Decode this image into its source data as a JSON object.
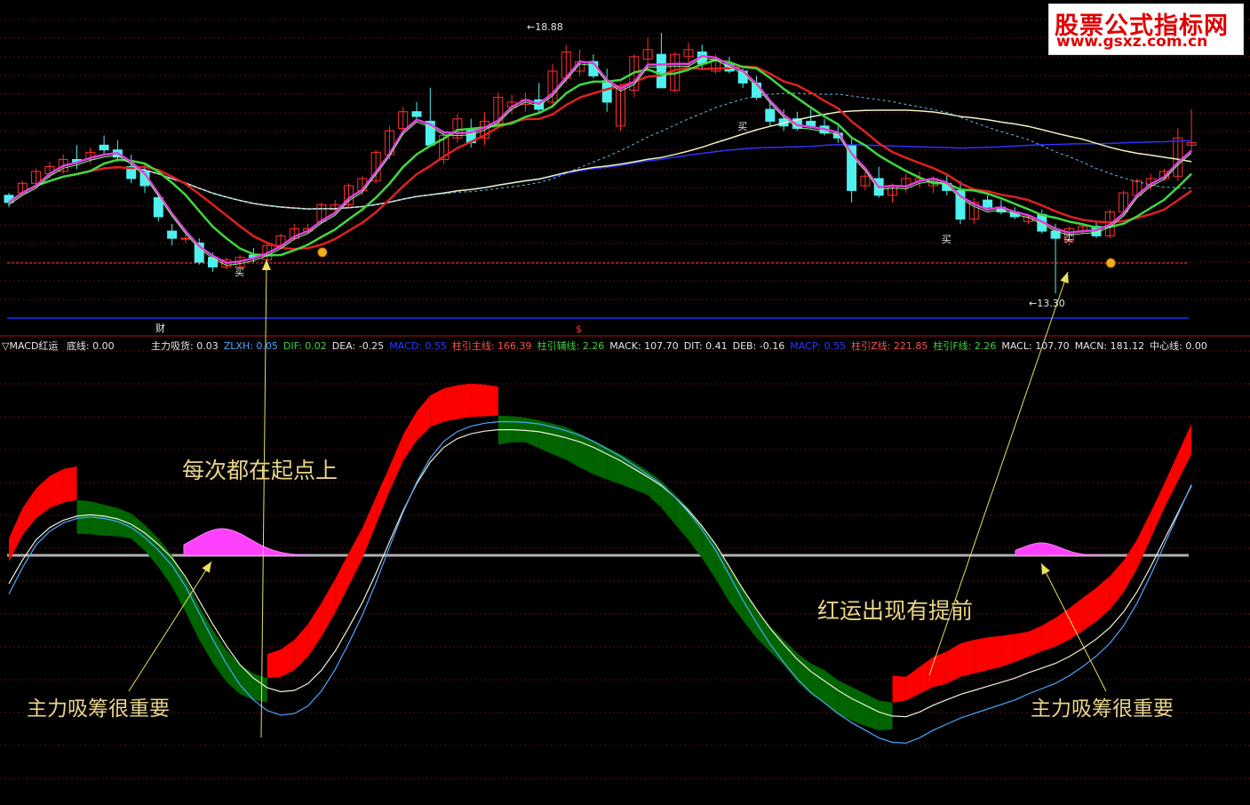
{
  "watermark": {
    "line1": "股票公式指标网",
    "line2": "www.gsxz.com.cn"
  },
  "price_panel": {
    "high_label": "18.88",
    "low_label": "13.30",
    "markers": {
      "buy": "买",
      "cai": "财",
      "dollar": "$"
    }
  },
  "indicator_header": {
    "title": "▽MACD红运",
    "base_label": "底线: 0.00",
    "items": [
      {
        "text": "主力吸货: 0.03",
        "color": "#e6e6e6"
      },
      {
        "text": "ZLXH: 0.05",
        "color": "#4da6ff"
      },
      {
        "text": "DIF: 0.02",
        "color": "#3fd13f"
      },
      {
        "text": "DEA: -0.25",
        "color": "#e6e6e6"
      },
      {
        "text": "MACD: 0.55",
        "color": "#2a3cff"
      },
      {
        "text": "柱引主线: 166.39",
        "color": "#ff5050"
      },
      {
        "text": "柱引辅线: 2.26",
        "color": "#3fd13f"
      },
      {
        "text": "MACK: 107.70",
        "color": "#e6e6e6"
      },
      {
        "text": "DIT: 0.41",
        "color": "#e6e6e6"
      },
      {
        "text": "DEB: -0.16",
        "color": "#e6e6e6"
      },
      {
        "text": "MACP: 0.55",
        "color": "#2a3cff"
      },
      {
        "text": "柱引Z线: 221.85",
        "color": "#ff5050"
      },
      {
        "text": "柱引F线: 2.26",
        "color": "#3fd13f"
      },
      {
        "text": "MACL: 107.70",
        "color": "#e6e6e6"
      },
      {
        "text": "MACN: 181.12",
        "color": "#e6e6e6"
      },
      {
        "text": "中心线: 0.00",
        "color": "#e6e6e6"
      }
    ]
  },
  "annotations": {
    "top_left": "每次都在起点上",
    "middle_right": "红运出现有提前",
    "bottom_left": "主力吸筹很重要",
    "bottom_right": "主力吸筹很重要"
  },
  "colors": {
    "up_candle": "#ff3030",
    "down_candle": "#4ef0f0",
    "ma_magenta": "#e040e0",
    "ma_green": "#40d840",
    "ma_red": "#e02020",
    "ma_white": "#f0f0c0",
    "ma_blue": "#3030ff",
    "ma_dashed": "#60c0e0",
    "band_red": "#ff0000",
    "band_green": "#006400",
    "annotation": "#e8d48a",
    "arrow": "#e8e060"
  },
  "chart_data": [
    {
      "type": "candlestick",
      "series": [
        {
          "name": "candles",
          "values": [
            [
              15.35,
              15.4,
              15.1,
              15.2
            ],
            [
              15.4,
              15.65,
              15.35,
              15.6
            ],
            [
              15.6,
              15.9,
              15.5,
              15.85
            ],
            [
              15.8,
              16.05,
              15.7,
              15.95
            ],
            [
              15.85,
              16.2,
              15.8,
              16.1
            ],
            [
              16.1,
              16.4,
              15.9,
              16.05
            ],
            [
              16.1,
              16.35,
              16.0,
              16.25
            ],
            [
              16.4,
              16.6,
              16.2,
              16.3
            ],
            [
              16.3,
              16.5,
              16.05,
              16.15
            ],
            [
              15.95,
              16.2,
              15.6,
              15.7
            ],
            [
              15.85,
              16.0,
              15.4,
              15.55
            ],
            [
              15.3,
              15.4,
              14.8,
              14.9
            ],
            [
              14.6,
              14.75,
              14.3,
              14.45
            ],
            [
              14.45,
              14.55,
              14.35,
              14.45
            ],
            [
              14.35,
              14.45,
              13.9,
              13.95
            ],
            [
              14.05,
              14.15,
              13.75,
              13.85
            ],
            [
              13.85,
              14.05,
              13.8,
              14.0
            ],
            [
              13.85,
              14.1,
              13.8,
              14.05
            ],
            [
              14.1,
              14.25,
              13.95,
              14.05
            ],
            [
              14.0,
              14.35,
              13.95,
              14.3
            ],
            [
              14.3,
              14.55,
              14.25,
              14.5
            ],
            [
              14.45,
              14.75,
              14.4,
              14.65
            ],
            [
              14.6,
              14.75,
              14.55,
              14.65
            ],
            [
              14.8,
              15.2,
              14.75,
              15.15
            ],
            [
              15.05,
              15.25,
              14.95,
              15.15
            ],
            [
              15.15,
              15.6,
              15.1,
              15.55
            ],
            [
              15.45,
              15.75,
              15.35,
              15.7
            ],
            [
              15.65,
              16.3,
              15.6,
              16.25
            ],
            [
              16.2,
              16.8,
              16.1,
              16.7
            ],
            [
              16.75,
              17.2,
              16.6,
              17.1
            ],
            [
              17.1,
              17.3,
              16.9,
              17.0
            ],
            [
              16.9,
              17.6,
              16.7,
              16.4
            ],
            [
              16.1,
              16.7,
              16.0,
              16.6
            ],
            [
              16.55,
              17.05,
              16.45,
              16.95
            ],
            [
              16.75,
              16.95,
              16.35,
              16.45
            ],
            [
              16.55,
              17.1,
              16.4,
              16.9
            ],
            [
              16.85,
              17.5,
              16.75,
              17.4
            ],
            [
              17.2,
              17.45,
              17.05,
              17.3
            ],
            [
              17.25,
              17.5,
              17.1,
              17.35
            ],
            [
              17.35,
              17.7,
              17.05,
              17.15
            ],
            [
              17.3,
              18.1,
              17.2,
              17.95
            ],
            [
              17.8,
              18.5,
              17.7,
              18.35
            ],
            [
              17.95,
              18.4,
              17.85,
              18.15
            ],
            [
              18.15,
              18.3,
              17.8,
              17.85
            ],
            [
              17.75,
              18.0,
              17.1,
              17.3
            ],
            [
              16.8,
              17.7,
              16.7,
              17.6
            ],
            [
              17.55,
              18.3,
              17.4,
              18.25
            ],
            [
              18.2,
              18.65,
              18.0,
              18.4
            ],
            [
              18.3,
              18.75,
              17.8,
              17.6
            ],
            [
              17.55,
              18.35,
              17.5,
              18.3
            ],
            [
              18.25,
              18.55,
              18.05,
              18.4
            ],
            [
              18.35,
              18.5,
              18.0,
              18.1
            ],
            [
              17.95,
              18.3,
              17.9,
              18.2
            ],
            [
              18.1,
              18.25,
              17.9,
              17.95
            ],
            [
              17.95,
              18.0,
              17.6,
              17.7
            ],
            [
              17.7,
              17.85,
              17.35,
              17.4
            ],
            [
              17.15,
              17.35,
              16.8,
              16.9
            ],
            [
              16.95,
              17.15,
              16.7,
              16.8
            ],
            [
              16.95,
              17.1,
              16.7,
              16.75
            ],
            [
              16.9,
              17.15,
              16.75,
              16.8
            ],
            [
              16.8,
              16.95,
              16.6,
              16.65
            ],
            [
              16.65,
              16.8,
              16.45,
              16.55
            ],
            [
              16.4,
              16.55,
              15.2,
              15.45
            ],
            [
              15.55,
              15.85,
              15.45,
              15.75
            ],
            [
              15.7,
              15.95,
              15.3,
              15.35
            ],
            [
              15.35,
              15.6,
              15.2,
              15.55
            ],
            [
              15.55,
              15.8,
              15.4,
              15.7
            ],
            [
              15.65,
              15.85,
              15.5,
              15.7
            ],
            [
              15.55,
              15.75,
              15.4,
              15.7
            ],
            [
              15.6,
              15.8,
              15.35,
              15.45
            ],
            [
              15.45,
              15.65,
              14.75,
              14.85
            ],
            [
              14.85,
              15.3,
              14.75,
              15.2
            ],
            [
              15.25,
              15.35,
              15.05,
              15.1
            ],
            [
              15.1,
              15.25,
              14.95,
              15.0
            ],
            [
              15.0,
              15.1,
              14.85,
              14.9
            ],
            [
              14.8,
              14.95,
              14.75,
              14.9
            ],
            [
              14.95,
              15.05,
              14.55,
              14.6
            ],
            [
              14.6,
              14.75,
              13.3,
              14.45
            ],
            [
              14.4,
              14.7,
              14.3,
              14.65
            ],
            [
              14.6,
              14.75,
              14.55,
              14.7
            ],
            [
              14.7,
              14.8,
              14.45,
              14.5
            ],
            [
              14.5,
              15.05,
              14.45,
              15.0
            ],
            [
              15.0,
              15.45,
              14.95,
              15.4
            ],
            [
              15.35,
              15.7,
              15.3,
              15.65
            ],
            [
              15.55,
              15.8,
              15.45,
              15.7
            ],
            [
              15.7,
              15.9,
              15.65,
              15.85
            ],
            [
              15.75,
              16.75,
              15.65,
              16.55
            ],
            [
              16.4,
              17.15,
              16.3,
              16.45
            ]
          ]
        }
      ]
    },
    {
      "type": "area",
      "series": [
        {
          "name": "MACD",
          "values": [
            -0.1,
            0.3,
            0.55,
            0.7,
            0.78,
            0.82,
            0.8,
            0.75,
            0.7,
            0.62,
            0.45,
            0.25,
            0.0,
            -0.35,
            -0.75,
            -1.1,
            -1.4,
            -1.62,
            -1.75,
            -1.82,
            -1.8,
            -1.7,
            -1.5,
            -1.2,
            -0.85,
            -0.45,
            -0.05,
            0.45,
            0.95,
            1.4,
            1.7,
            1.9,
            1.98,
            2.02,
            2.05,
            2.06,
            2.07,
            2.06,
            2.04,
            2.0,
            1.95,
            1.9,
            1.8,
            1.7,
            1.6,
            1.5,
            1.38,
            1.25,
            1.1,
            0.9,
            0.7,
            0.45,
            0.15,
            -0.2,
            -0.5,
            -0.8,
            -1.05,
            -1.25,
            -1.45,
            -1.6,
            -1.7,
            -1.85,
            -1.95,
            -2.05,
            -2.15,
            -2.18,
            -2.15,
            -2.05,
            -1.95,
            -1.9,
            -1.8,
            -1.75,
            -1.7,
            -1.65,
            -1.58,
            -1.5,
            -1.42,
            -1.35,
            -1.25,
            -1.12,
            -0.98,
            -0.8,
            -0.55,
            -0.2,
            0.25,
            0.7,
            1.1,
            1.5
          ]
        },
        {
          "name": "DIF",
          "values": [
            -0.2,
            0.15,
            0.45,
            0.63,
            0.74,
            0.8,
            0.82,
            0.8,
            0.76,
            0.68,
            0.55,
            0.38,
            0.18,
            -0.1,
            -0.45,
            -0.8,
            -1.12,
            -1.4,
            -1.6,
            -1.74,
            -1.8,
            -1.78,
            -1.68,
            -1.48,
            -1.2,
            -0.85,
            -0.48,
            -0.05,
            0.42,
            0.88,
            1.28,
            1.6,
            1.82,
            1.95,
            2.02,
            2.06,
            2.08,
            2.08,
            2.07,
            2.05,
            2.01,
            1.96,
            1.9,
            1.82,
            1.72,
            1.62,
            1.5,
            1.38,
            1.25,
            1.08,
            0.88,
            0.65,
            0.38,
            0.05,
            -0.28,
            -0.58,
            -0.86,
            -1.1,
            -1.32,
            -1.5,
            -1.64,
            -1.78,
            -1.9,
            -2.0,
            -2.1,
            -2.16,
            -2.17,
            -2.1,
            -2.0,
            -1.92,
            -1.84,
            -1.78,
            -1.72,
            -1.66,
            -1.6,
            -1.52,
            -1.45,
            -1.38,
            -1.28,
            -1.16,
            -1.02,
            -0.85,
            -0.62,
            -0.32,
            0.05,
            0.45,
            0.85,
            1.25
          ]
        }
      ]
    }
  ]
}
